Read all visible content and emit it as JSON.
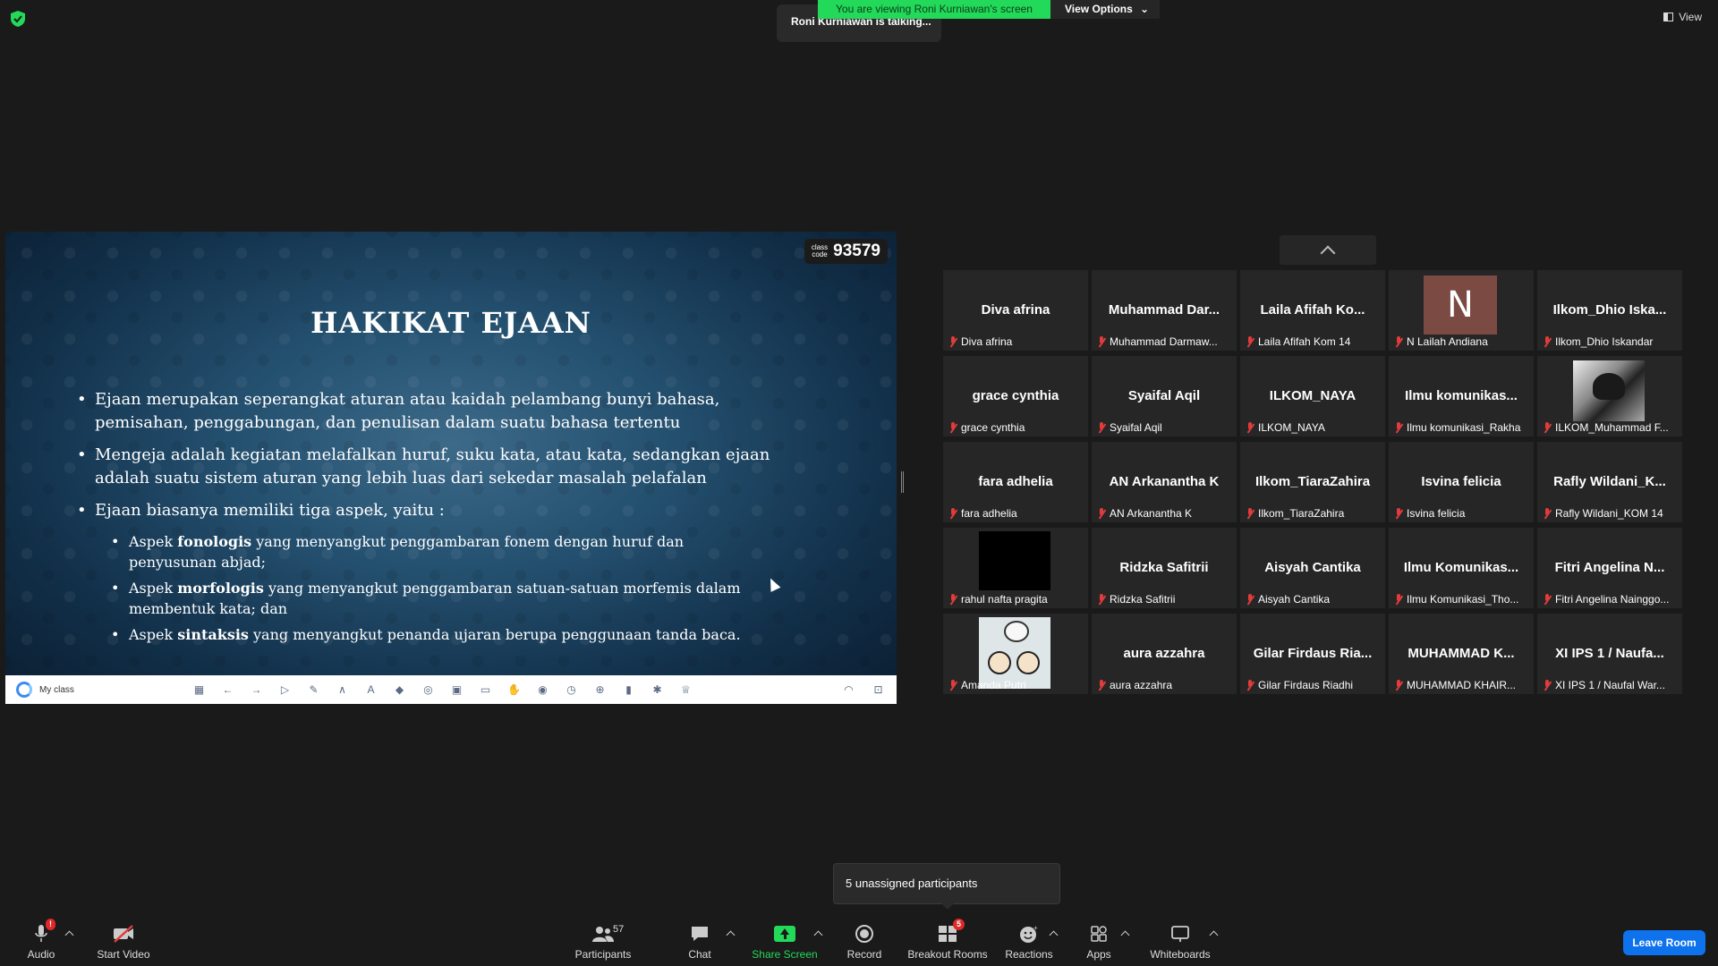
{
  "top": {
    "banner_text": "You are viewing Roni Kurniawan's screen",
    "view_options_label": "View Options",
    "talking_text": "Roni Kurniawan is talking...",
    "view_label": "View"
  },
  "share": {
    "class_code_label_1": "class",
    "class_code_label_2": "code",
    "class_code": "93579",
    "title": "HAKIKAT EJAAN",
    "bullets": [
      "Ejaan merupakan seperangkat aturan atau kaidah pelambang bunyi bahasa, pemisahan, penggabungan, dan penulisan dalam suatu bahasa tertentu",
      "Mengeja adalah kegiatan melafalkan huruf, suku kata, atau kata, sedangkan ejaan adalah suatu sistem aturan yang lebih luas dari sekedar masalah pelafalan",
      "Ejaan biasanya memiliki tiga aspek, yaitu :"
    ],
    "sub_bullets": [
      {
        "pre": "Aspek ",
        "bold": "fonologis",
        "post": " yang menyangkut penggambaran fonem dengan huruf dan penyusunan abjad;"
      },
      {
        "pre": "Aspek ",
        "bold": "morfologis",
        "post": " yang menyangkut penggambaran satuan-satuan morfemis dalam membentuk kata; dan"
      },
      {
        "pre": "Aspek ",
        "bold": "sintaksis",
        "post": " yang menyangkut penanda ujaran berupa penggunaan tanda baca."
      }
    ],
    "classbar_label": "My class"
  },
  "participants": [
    {
      "name": "Diva afrina",
      "label": "Diva afrina",
      "avatar": "none"
    },
    {
      "name": "Muhammad  Dar...",
      "label": "Muhammad Darmaw...",
      "avatar": "none"
    },
    {
      "name": "Laila Afifah Ko...",
      "label": "Laila Afifah Kom 14",
      "avatar": "none"
    },
    {
      "name": "",
      "label": "N Lailah Andiana",
      "avatar": "initial",
      "initial": "N"
    },
    {
      "name": "Ilkom_Dhio  Iska...",
      "label": "Ilkom_Dhio Iskandar",
      "avatar": "none"
    },
    {
      "name": "grace cynthia",
      "label": "grace cynthia",
      "avatar": "none"
    },
    {
      "name": "Syaifal Aqil",
      "label": "Syaifal Aqil",
      "avatar": "none"
    },
    {
      "name": "ILKOM_NAYA",
      "label": "ILKOM_NAYA",
      "avatar": "none"
    },
    {
      "name": "Ilmu  komunikas...",
      "label": "Ilmu komunikasi_Rakha",
      "avatar": "none"
    },
    {
      "name": "",
      "label": "ILKOM_Muhammad F...",
      "avatar": "photo"
    },
    {
      "name": "fara adhelia",
      "label": "fara adhelia",
      "avatar": "none"
    },
    {
      "name": "AN Arkanantha K",
      "label": "AN Arkanantha K",
      "avatar": "none"
    },
    {
      "name": "Ilkom_TiaraZahira",
      "label": "Ilkom_TiaraZahira",
      "avatar": "none"
    },
    {
      "name": "Isvina felicia",
      "label": "Isvina felicia",
      "avatar": "none"
    },
    {
      "name": "Rafly  Wildani_K...",
      "label": "Rafly Wildani_KOM 14",
      "avatar": "none"
    },
    {
      "name": "",
      "label": "rahul nafta pragita",
      "avatar": "black"
    },
    {
      "name": "Ridzka Safitrii",
      "label": "Ridzka Safitrii",
      "avatar": "none"
    },
    {
      "name": "Aisyah Cantika",
      "label": "Aisyah Cantika",
      "avatar": "none"
    },
    {
      "name": "Ilmu  Komunikas...",
      "label": "Ilmu Komunikasi_Tho...",
      "avatar": "none"
    },
    {
      "name": "Fitri Angelina N...",
      "label": "Fitri Angelina Nainggo...",
      "avatar": "none"
    },
    {
      "name": "",
      "label": "Amanda Putri",
      "avatar": "cartoon"
    },
    {
      "name": "aura azzahra",
      "label": "aura azzahra",
      "avatar": "none"
    },
    {
      "name": "Gilar Firdaus Ria...",
      "label": "Gilar Firdaus Riadhi",
      "avatar": "none"
    },
    {
      "name": "MUHAMMAD  K...",
      "label": "MUHAMMAD KHAIR...",
      "avatar": "none"
    },
    {
      "name": "XI IPS 1 / Naufa...",
      "label": "XI IPS 1 / Naufal War...",
      "avatar": "none"
    }
  ],
  "popover": {
    "text": "5 unassigned participants"
  },
  "toolbar": {
    "audio": "Audio",
    "audio_badge": "!",
    "start_video": "Start Video",
    "participants": "Participants",
    "participants_count": "57",
    "chat": "Chat",
    "share_screen": "Share Screen",
    "record": "Record",
    "breakout_rooms": "Breakout Rooms",
    "breakout_badge": "5",
    "reactions": "Reactions",
    "apps": "Apps",
    "whiteboards": "Whiteboards",
    "leave": "Leave Room"
  },
  "colors": {
    "accent_green": "#23d959",
    "leave_blue": "#0e72ed",
    "mute_red": "#e23b3b",
    "background": "#1a1a1a"
  }
}
